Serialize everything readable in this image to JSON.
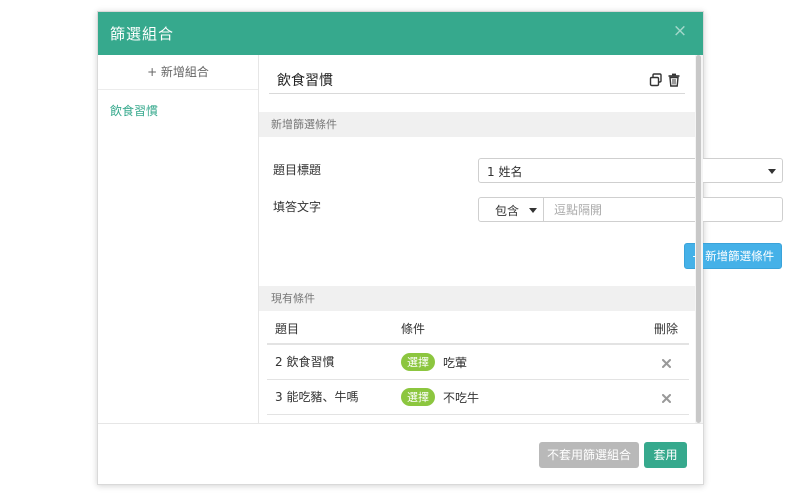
{
  "modal": {
    "title": "篩選組合",
    "close_symbol": "×"
  },
  "sidebar": {
    "add_label": "+ 新增組合",
    "items": [
      {
        "label": "飲食習慣"
      }
    ]
  },
  "editor": {
    "combo_name": "飲食習慣",
    "icons": [
      "copy-icon",
      "trash-icon"
    ]
  },
  "new_condition": {
    "section_title": "新增篩選條件",
    "question_label": "題目標題",
    "question_value": "1 姓名",
    "answer_label": "填答文字",
    "operator_value": "包含",
    "answer_placeholder": "逗點隔開",
    "add_button": "+ 新增篩選條件"
  },
  "existing": {
    "section_title": "現有條件",
    "headers": [
      "題目",
      "條件",
      "刪除"
    ],
    "rows": [
      {
        "question": "2 飲食習慣",
        "badge": "選擇",
        "value": "吃葷"
      },
      {
        "question": "3 能吃豬、牛嗎",
        "badge": "選擇",
        "value": "不吃牛"
      }
    ]
  },
  "footer": {
    "disable_button": "不套用篩選組合",
    "apply_button": "套用"
  },
  "colors": {
    "header": "#36a98d",
    "primary_button": "#45b1e8",
    "badge": "#8cc63f",
    "disabled_button": "#b9b9b9"
  }
}
